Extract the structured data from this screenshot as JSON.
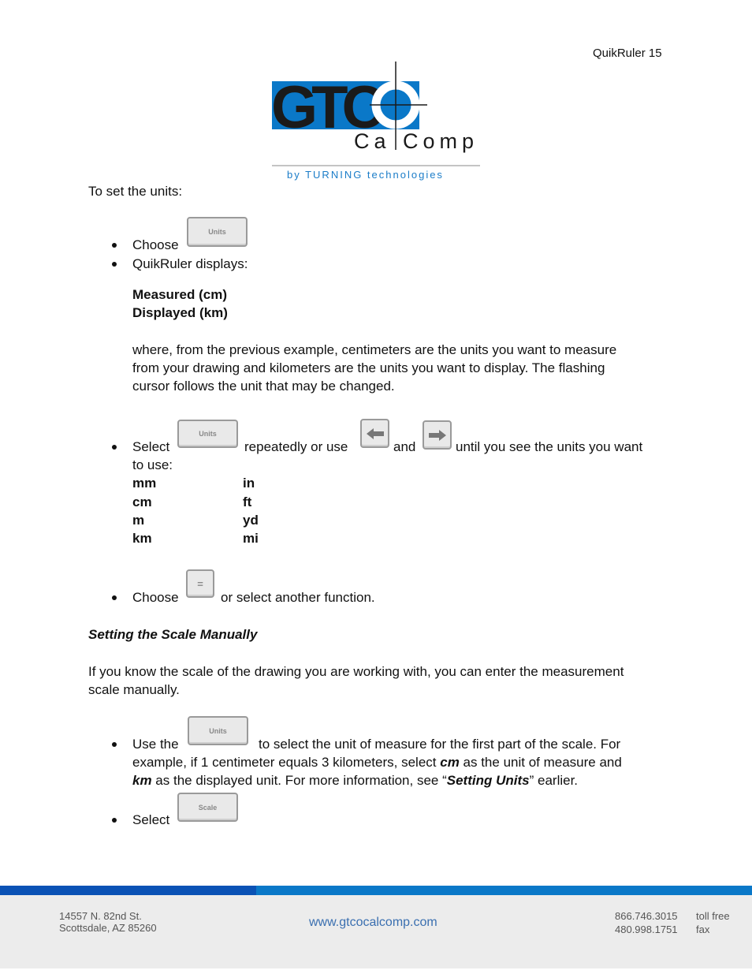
{
  "header": {
    "page_label": "QuikRuler 15"
  },
  "logo": {
    "text": "GTCO CalComp",
    "tagline": "by TURNING technologies",
    "colors": {
      "blue": "#0a78c8",
      "black": "#1a1a1a"
    }
  },
  "body": {
    "intro": "To set the units:",
    "b1_pre": "Choose",
    "b1_key": "Units",
    "b2": "QuikRuler displays:",
    "measured": "Measured (cm)",
    "displayed": "Displayed (km)",
    "para1": [
      "where, from the previous example, centimeters are the units you want to measure",
      "from your drawing and kilometers are the units you want to display.  The flashing",
      "cursor follows the unit that may be changed."
    ],
    "b3_select": "Select",
    "b3_key": "Units",
    "b3_mid": "repeatedly or use",
    "b3_and": "and",
    "b3_end": "until you see the units you want",
    "b3_line2": "to use:",
    "units_left": [
      "mm",
      "cm",
      "m",
      "km"
    ],
    "units_right": [
      "in",
      "ft",
      "yd",
      "mi"
    ],
    "b4_pre": "Choose",
    "b4_key": "=",
    "b4_post": "or select another function.",
    "heading": "Setting the Scale Manually",
    "para2": [
      "If you know the scale of the drawing you are working with, you can enter the measurement",
      "scale manually."
    ],
    "b5_pre": "Use the",
    "b5_key": "Units",
    "b5_post": "to select the unit of measure for the first part of the scale.  For",
    "b5_l2a": "example, if 1 centimeter equals 3 kilometers, select ",
    "b5_l2b": "cm",
    "b5_l2c": " as the unit of measure and",
    "b5_l3a": "km",
    "b5_l3b": " as the displayed unit.  For more information, see “",
    "b5_l3c": "Setting Units",
    "b5_l3d": "” earlier.",
    "b6_pre": "Select",
    "b6_key": "Scale"
  },
  "footer": {
    "address1": "14557 N. 82nd St.",
    "address2": "Scottsdale, AZ 85260",
    "website": "www.gtcocalcomp.com",
    "phone1": "866.746.3015",
    "phone1_label": "toll free",
    "phone2": "480.998.1751",
    "phone2_label": "fax"
  }
}
